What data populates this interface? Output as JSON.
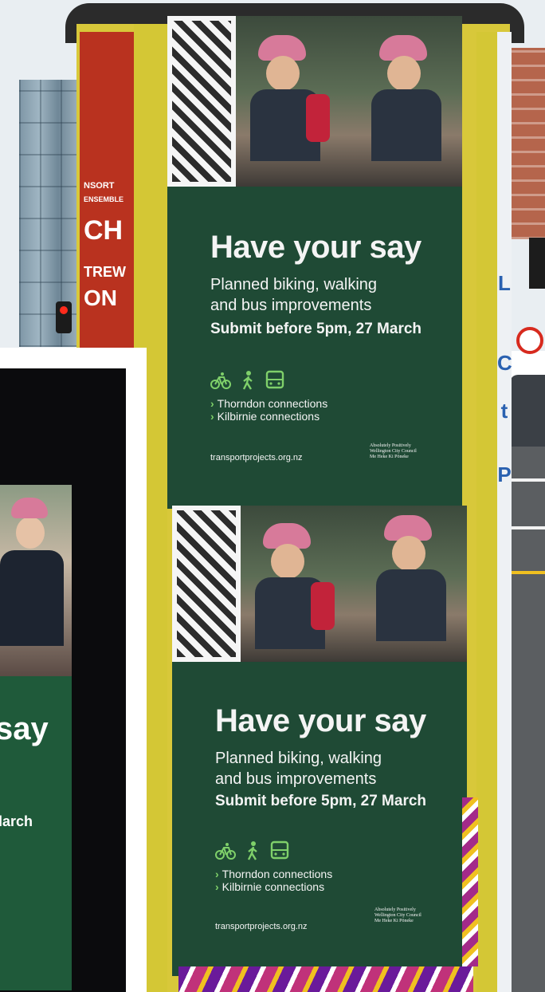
{
  "poster": {
    "headline": "Have your say",
    "sub_line_1": "Planned biking, walking",
    "sub_line_2": "and bus improvements",
    "deadline": "Submit before 5pm, 27 March",
    "mode_icons": [
      "bike-icon",
      "walk-icon",
      "bus-icon"
    ],
    "connections": [
      "Thorndon connections",
      "Kilbirnie connections"
    ],
    "url": "transportprojects.org.nz",
    "council_line_1": "Absolutely Positively",
    "council_line_2": "Wellington City Council",
    "council_line_3": "Me Heke Ki Pōneke"
  },
  "kiosk": {
    "red_panel_lines": [
      "NSORT",
      "ENSEMBLE",
      "CH",
      "TREW",
      "ON"
    ],
    "blue_letters": [
      "L",
      "C",
      "t",
      "P"
    ]
  },
  "inset": {
    "headline_fragment": "say",
    "deadline_fragment": "larch"
  },
  "colors": {
    "poster_green": "#1f4a35",
    "accent_green": "#7fd06a",
    "kiosk_yellow": "#d4c735",
    "red_panel": "#b9321f"
  }
}
